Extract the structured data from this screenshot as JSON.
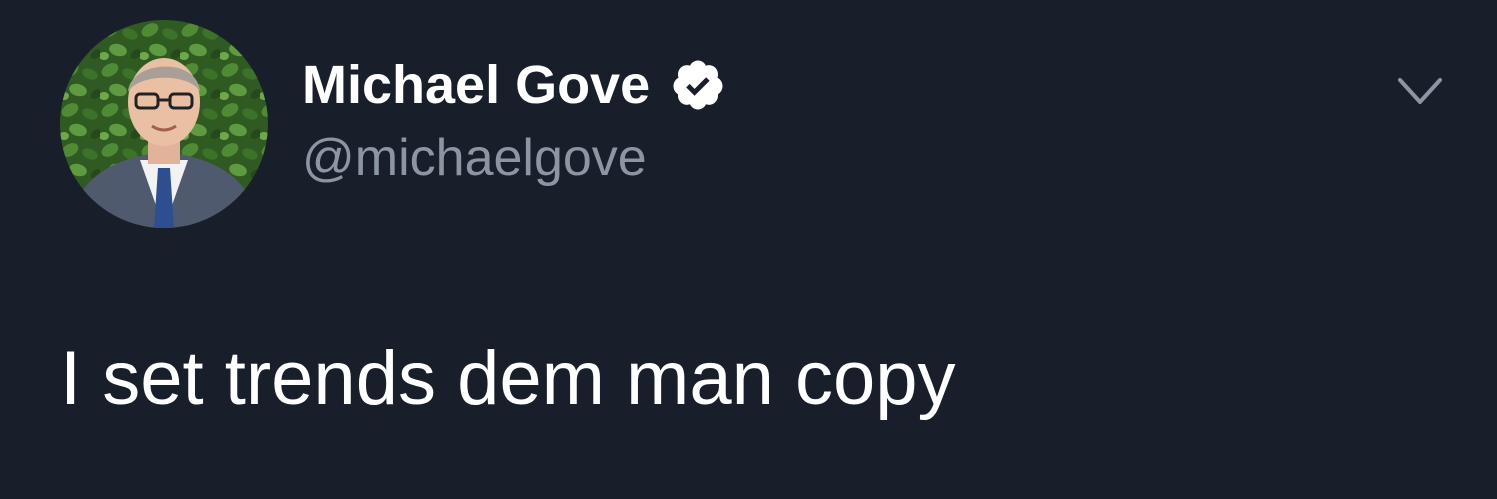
{
  "tweet": {
    "author": {
      "display_name": "Michael Gove",
      "handle": "@michaelgove",
      "verified": true,
      "avatar_icon": "profile-photo"
    },
    "text": "I set trends dem man copy",
    "menu_icon": "chevron-down-icon"
  },
  "colors": {
    "background": "#191e2b",
    "name_text": "#ffffff",
    "handle_text": "#8b96a2",
    "body_text": "#ffffff",
    "verified_badge": "#ffffff"
  }
}
